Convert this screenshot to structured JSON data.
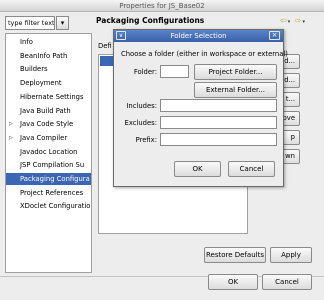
{
  "window": {
    "title": "Properties for JS_Base02"
  },
  "filter": {
    "value": "type filter text"
  },
  "tree": {
    "items": [
      {
        "label": "Info",
        "expandable": false,
        "selected": false
      },
      {
        "label": "BeanInfo Path",
        "expandable": false,
        "selected": false
      },
      {
        "label": "Builders",
        "expandable": false,
        "selected": false
      },
      {
        "label": "Deployment",
        "expandable": false,
        "selected": false
      },
      {
        "label": "Hibernate Settings",
        "expandable": false,
        "selected": false
      },
      {
        "label": "Java Build Path",
        "expandable": false,
        "selected": false
      },
      {
        "label": "Java Code Style",
        "expandable": true,
        "selected": false
      },
      {
        "label": "Java Compiler",
        "expandable": true,
        "selected": false
      },
      {
        "label": "Javadoc Location",
        "expandable": false,
        "selected": false
      },
      {
        "label": "JSP Compilation Su",
        "expandable": false,
        "selected": false
      },
      {
        "label": "Packaging Configura",
        "expandable": false,
        "selected": true
      },
      {
        "label": "Project References",
        "expandable": false,
        "selected": false
      },
      {
        "label": "XDoclet Configuratio",
        "expandable": false,
        "selected": false
      }
    ]
  },
  "page": {
    "title": "Packaging Configurations",
    "definitions_label": "Defi",
    "right_edge_text": "n.",
    "side_buttons": [
      "d...",
      "ndard...",
      "t...",
      "move",
      "p",
      "wn"
    ]
  },
  "footer": {
    "restore_defaults": "Restore Defaults",
    "apply": "Apply",
    "ok": "OK",
    "cancel": "Cancel"
  },
  "dialog": {
    "title": "Folder Selection",
    "menu_icon": "window-menu-icon",
    "close_icon": "close-icon",
    "instruction": "Choose a folder (either in workspace or external)",
    "folder_label": "Folder:",
    "folder_value": "",
    "project_folder_button": "Project Folder...",
    "external_folder_button": "External Folder...",
    "includes_label": "Includes:",
    "includes_value": "",
    "excludes_label": "Excludes:",
    "excludes_value": "",
    "prefix_label": "Prefix:",
    "prefix_value": "",
    "ok": "OK",
    "cancel": "Cancel"
  },
  "colors": {
    "selection": "#3b66b3",
    "dialog_titlebar": "#4a72b9",
    "window_bg": "#ededed"
  }
}
